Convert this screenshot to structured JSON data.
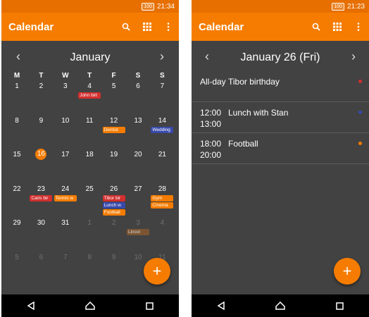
{
  "colors": {
    "accent": "#f57c00",
    "status": "#e76f00",
    "background": "#424242"
  },
  "left_screen": {
    "status": {
      "battery": "100",
      "time": "21:34"
    },
    "appbar": {
      "title": "Calendar",
      "icons": [
        "search-icon",
        "grid-icon",
        "more-vert-icon"
      ]
    },
    "month": {
      "title": "January",
      "weekdays": [
        "M",
        "T",
        "W",
        "T",
        "F",
        "S",
        "S"
      ],
      "weeks": [
        [
          {
            "d": "1"
          },
          {
            "d": "2"
          },
          {
            "d": "3"
          },
          {
            "d": "4",
            "events": [
              {
                "label": "John birt",
                "color": "#d32f2f"
              }
            ]
          },
          {
            "d": "5"
          },
          {
            "d": "6"
          },
          {
            "d": "7"
          }
        ],
        [
          {
            "d": "8"
          },
          {
            "d": "9"
          },
          {
            "d": "10"
          },
          {
            "d": "11"
          },
          {
            "d": "12",
            "events": [
              {
                "label": "Dentist",
                "color": "#f57c00"
              }
            ]
          },
          {
            "d": "13"
          },
          {
            "d": "14",
            "events": [
              {
                "label": "Wedding",
                "color": "#3949ab"
              }
            ]
          }
        ],
        [
          {
            "d": "15"
          },
          {
            "d": "16",
            "today": true
          },
          {
            "d": "17"
          },
          {
            "d": "18"
          },
          {
            "d": "19"
          },
          {
            "d": "20"
          },
          {
            "d": "21"
          }
        ],
        [
          {
            "d": "22"
          },
          {
            "d": "23",
            "events": [
              {
                "label": "Caris bir",
                "color": "#d32f2f"
              }
            ]
          },
          {
            "d": "24",
            "events": [
              {
                "label": "Tennis w",
                "color": "#f57c00"
              }
            ]
          },
          {
            "d": "25"
          },
          {
            "d": "26",
            "events": [
              {
                "label": "Tibor bir",
                "color": "#d32f2f"
              },
              {
                "label": "Lunch w",
                "color": "#3949ab"
              },
              {
                "label": "Football",
                "color": "#f57c00"
              }
            ]
          },
          {
            "d": "27"
          },
          {
            "d": "28",
            "events": [
              {
                "label": "Gym",
                "color": "#f57c00"
              },
              {
                "label": "Cinema",
                "color": "#f57c00"
              }
            ]
          }
        ],
        [
          {
            "d": "29"
          },
          {
            "d": "30"
          },
          {
            "d": "31"
          },
          {
            "d": "1",
            "other": true
          },
          {
            "d": "2",
            "other": true
          },
          {
            "d": "3",
            "other": true,
            "events": [
              {
                "label": "Lincol",
                "color": "#8a5a30"
              }
            ]
          },
          {
            "d": "4",
            "other": true
          }
        ],
        [
          {
            "d": "5",
            "other": true
          },
          {
            "d": "6",
            "other": true
          },
          {
            "d": "7",
            "other": true
          },
          {
            "d": "8",
            "other": true
          },
          {
            "d": "9",
            "other": true
          },
          {
            "d": "10",
            "other": true
          },
          {
            "d": "11",
            "other": true
          }
        ]
      ]
    },
    "fab": "+"
  },
  "right_screen": {
    "status": {
      "battery": "100",
      "time": "21:23"
    },
    "appbar": {
      "title": "Calendar",
      "icons": [
        "search-icon",
        "grid-icon",
        "more-vert-icon"
      ]
    },
    "day": {
      "title": "January 26 (Fri)",
      "events": [
        {
          "start": "All-day",
          "end": "",
          "title": "Tibor birthday",
          "color": "#d32f2f"
        },
        {
          "start": "12:00",
          "end": "13:00",
          "title": "Lunch with Stan",
          "color": "#3949ab"
        },
        {
          "start": "18:00",
          "end": "20:00",
          "title": "Football",
          "color": "#f57c00"
        }
      ]
    },
    "fab": "+"
  }
}
